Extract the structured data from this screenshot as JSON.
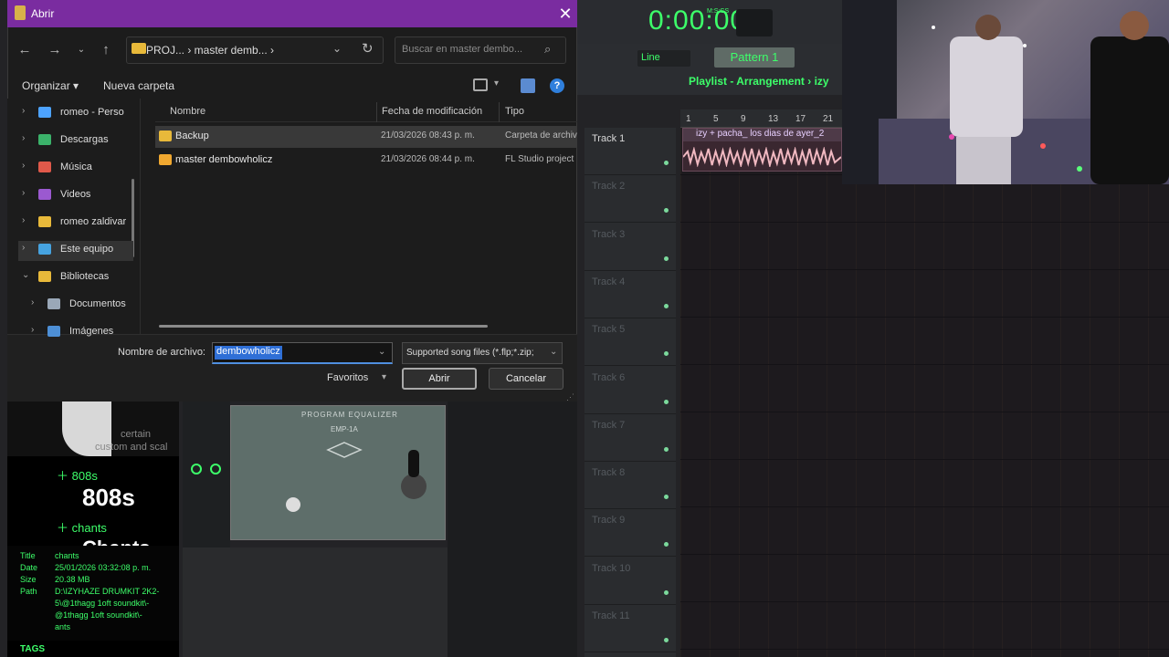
{
  "dialog": {
    "title": "Abrir",
    "close_label": "✕",
    "address_path": "PROJ... › master demb... ›",
    "search_placeholder": "Buscar en master dembo...",
    "toolbar": {
      "organize_label": "Organizar ▾",
      "new_folder_label": "Nueva carpeta"
    },
    "nav_items": [
      {
        "label": "romeo - Perso",
        "icon": "cloud-icon",
        "color": "#4da3ff"
      },
      {
        "label": "Descargas",
        "icon": "download-icon",
        "color": "#3bb26a"
      },
      {
        "label": "Música",
        "icon": "music-icon",
        "color": "#e0594a"
      },
      {
        "label": "Videos",
        "icon": "video-icon",
        "color": "#9b59d0"
      },
      {
        "label": "romeo zaldivar",
        "icon": "folder-icon",
        "color": "#e8b93a"
      },
      {
        "label": "Este equipo",
        "icon": "computer-icon",
        "color": "#46a3e0"
      },
      {
        "label": "Bibliotecas",
        "icon": "folder-icon",
        "color": "#e8b93a"
      },
      {
        "label": "Documentos",
        "icon": "document-icon",
        "color": "#9aa8b8"
      },
      {
        "label": "Imágenes",
        "icon": "image-icon",
        "color": "#4d8fd6"
      }
    ],
    "columns": {
      "name": "Nombre",
      "date": "Fecha de modificación",
      "type": "Tipo"
    },
    "files": [
      {
        "name": "Backup",
        "date": "21/03/2026 08:43 p. m.",
        "type": "Carpeta de archivos",
        "icon_color": "#e8b93a"
      },
      {
        "name": "master dembowholicz",
        "date": "21/03/2026 08:44 p. m.",
        "type": "FL Studio project",
        "icon_color": "#f0a830"
      }
    ],
    "filename_label": "Nombre de archivo:",
    "filename_value": "dembowholicz",
    "filetype_value": "Supported song files (*.flp;*.zip;",
    "favorites_label": "Favoritos",
    "open_label": "Abrir",
    "cancel_label": "Cancelar"
  },
  "fl": {
    "time": "0:00:00",
    "msec_label": "M:S:CS",
    "snap": "Line",
    "pattern": "Pattern 1",
    "playlist_title": "Playlist - Arrangement › izy",
    "ruler": [
      "1",
      "5",
      "9",
      "13",
      "17",
      "21"
    ],
    "tracks": [
      "Track 1",
      "Track 2",
      "Track 3",
      "Track 4",
      "Track 5",
      "Track 6",
      "Track 7",
      "Track 8",
      "Track 9",
      "Track 10",
      "Track 11"
    ],
    "clip_title": "izy + pacha_ los dias de ayer_2",
    "browser_items": [
      "808s",
      "chants"
    ],
    "browser_big": [
      "808s",
      "Chants"
    ],
    "art_text": [
      "certain",
      "custom and scal"
    ],
    "info": [
      {
        "key": "Title",
        "value": "chants"
      },
      {
        "key": "Date",
        "value": "25/01/2026 03:32:08 p. m."
      },
      {
        "key": "Size",
        "value": "20.38 MB"
      },
      {
        "key": "Path",
        "value": "D:\\IZYHAZE DRUMKIT 2K2-"
      }
    ],
    "path_lines": [
      "5\\@1thagg 1oft soundkit\\-",
      "@1thagg 1oft soundkit\\-",
      "ants"
    ],
    "tags_label": "TAGS",
    "plugin_name": "PROGRAM EQUALIZER",
    "plugin_sub": "EMP-1A"
  },
  "colors": {
    "accent_green": "#3dff6a",
    "title_purple": "#7a2ca0",
    "selection_blue": "#2f6fd6"
  }
}
